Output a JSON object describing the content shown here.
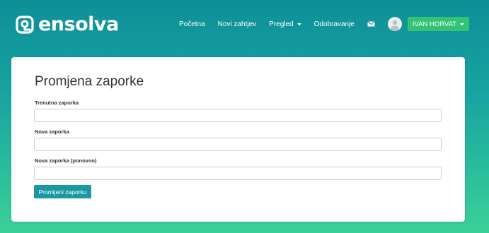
{
  "brand": {
    "name": "ensolva",
    "icon": "ensolva-logo-mark"
  },
  "nav": {
    "items": [
      {
        "label": "Početna",
        "has_dropdown": false
      },
      {
        "label": "Novi zahtjev",
        "has_dropdown": false
      },
      {
        "label": "Pregled",
        "has_dropdown": true
      },
      {
        "label": "Odobravanje",
        "has_dropdown": false
      }
    ],
    "mail_icon": "envelope-icon",
    "avatar_icon": "user-avatar-icon",
    "user_name": "IVAN HORVAT",
    "user_button_color": "#34c274"
  },
  "form": {
    "title": "Promjena zaporke",
    "fields": [
      {
        "label": "Trenutna zaporka",
        "value": "",
        "placeholder": ""
      },
      {
        "label": "Nova zaporka",
        "value": "",
        "placeholder": ""
      },
      {
        "label": "Nova zaporka (ponovno)",
        "value": "",
        "placeholder": ""
      }
    ],
    "submit_label": "Promijeni zaporku",
    "submit_color": "#1a9aa0"
  },
  "colors": {
    "background_top": "#0e8f98",
    "background_bottom": "#3ccf9a"
  }
}
